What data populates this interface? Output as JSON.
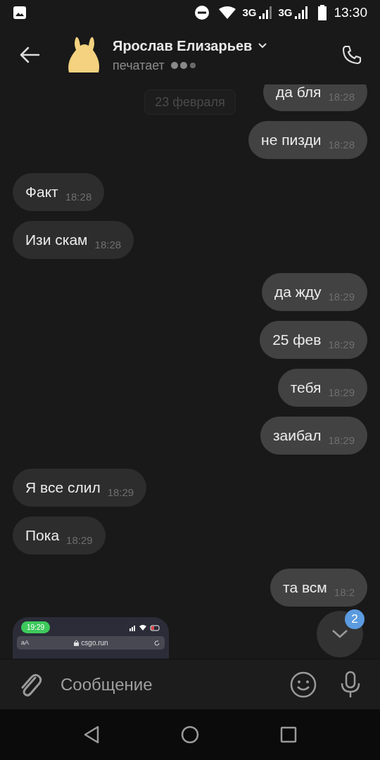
{
  "status_bar": {
    "time": "13:30",
    "network_1": "3G",
    "network_2": "3G"
  },
  "header": {
    "contact_name": "Ярослав Елизарьев",
    "status": "печатает"
  },
  "date_chip": "23 февраля",
  "messages": [
    {
      "text": "да бля",
      "time": "18:28",
      "outgoing": true
    },
    {
      "text": "не пизди",
      "time": "18:28",
      "outgoing": true
    },
    {
      "text": "Факт",
      "time": "18:28",
      "outgoing": false
    },
    {
      "text": "Изи скам",
      "time": "18:28",
      "outgoing": false
    },
    {
      "text": "да жду",
      "time": "18:29",
      "outgoing": true
    },
    {
      "text": "25 фев",
      "time": "18:29",
      "outgoing": true
    },
    {
      "text": "тебя",
      "time": "18:29",
      "outgoing": true
    },
    {
      "text": "заибал",
      "time": "18:29",
      "outgoing": true
    },
    {
      "text": "Я все слил",
      "time": "18:29",
      "outgoing": false
    },
    {
      "text": "Пока",
      "time": "18:29",
      "outgoing": false
    },
    {
      "text": "та всм",
      "time": "18:2",
      "outgoing": true
    }
  ],
  "screenshot_message": {
    "time": "19:29",
    "text_size_label": "аА",
    "url": "csgo.run"
  },
  "scroll_button": {
    "unread_count": "2"
  },
  "composer": {
    "placeholder": "Сообщение"
  }
}
